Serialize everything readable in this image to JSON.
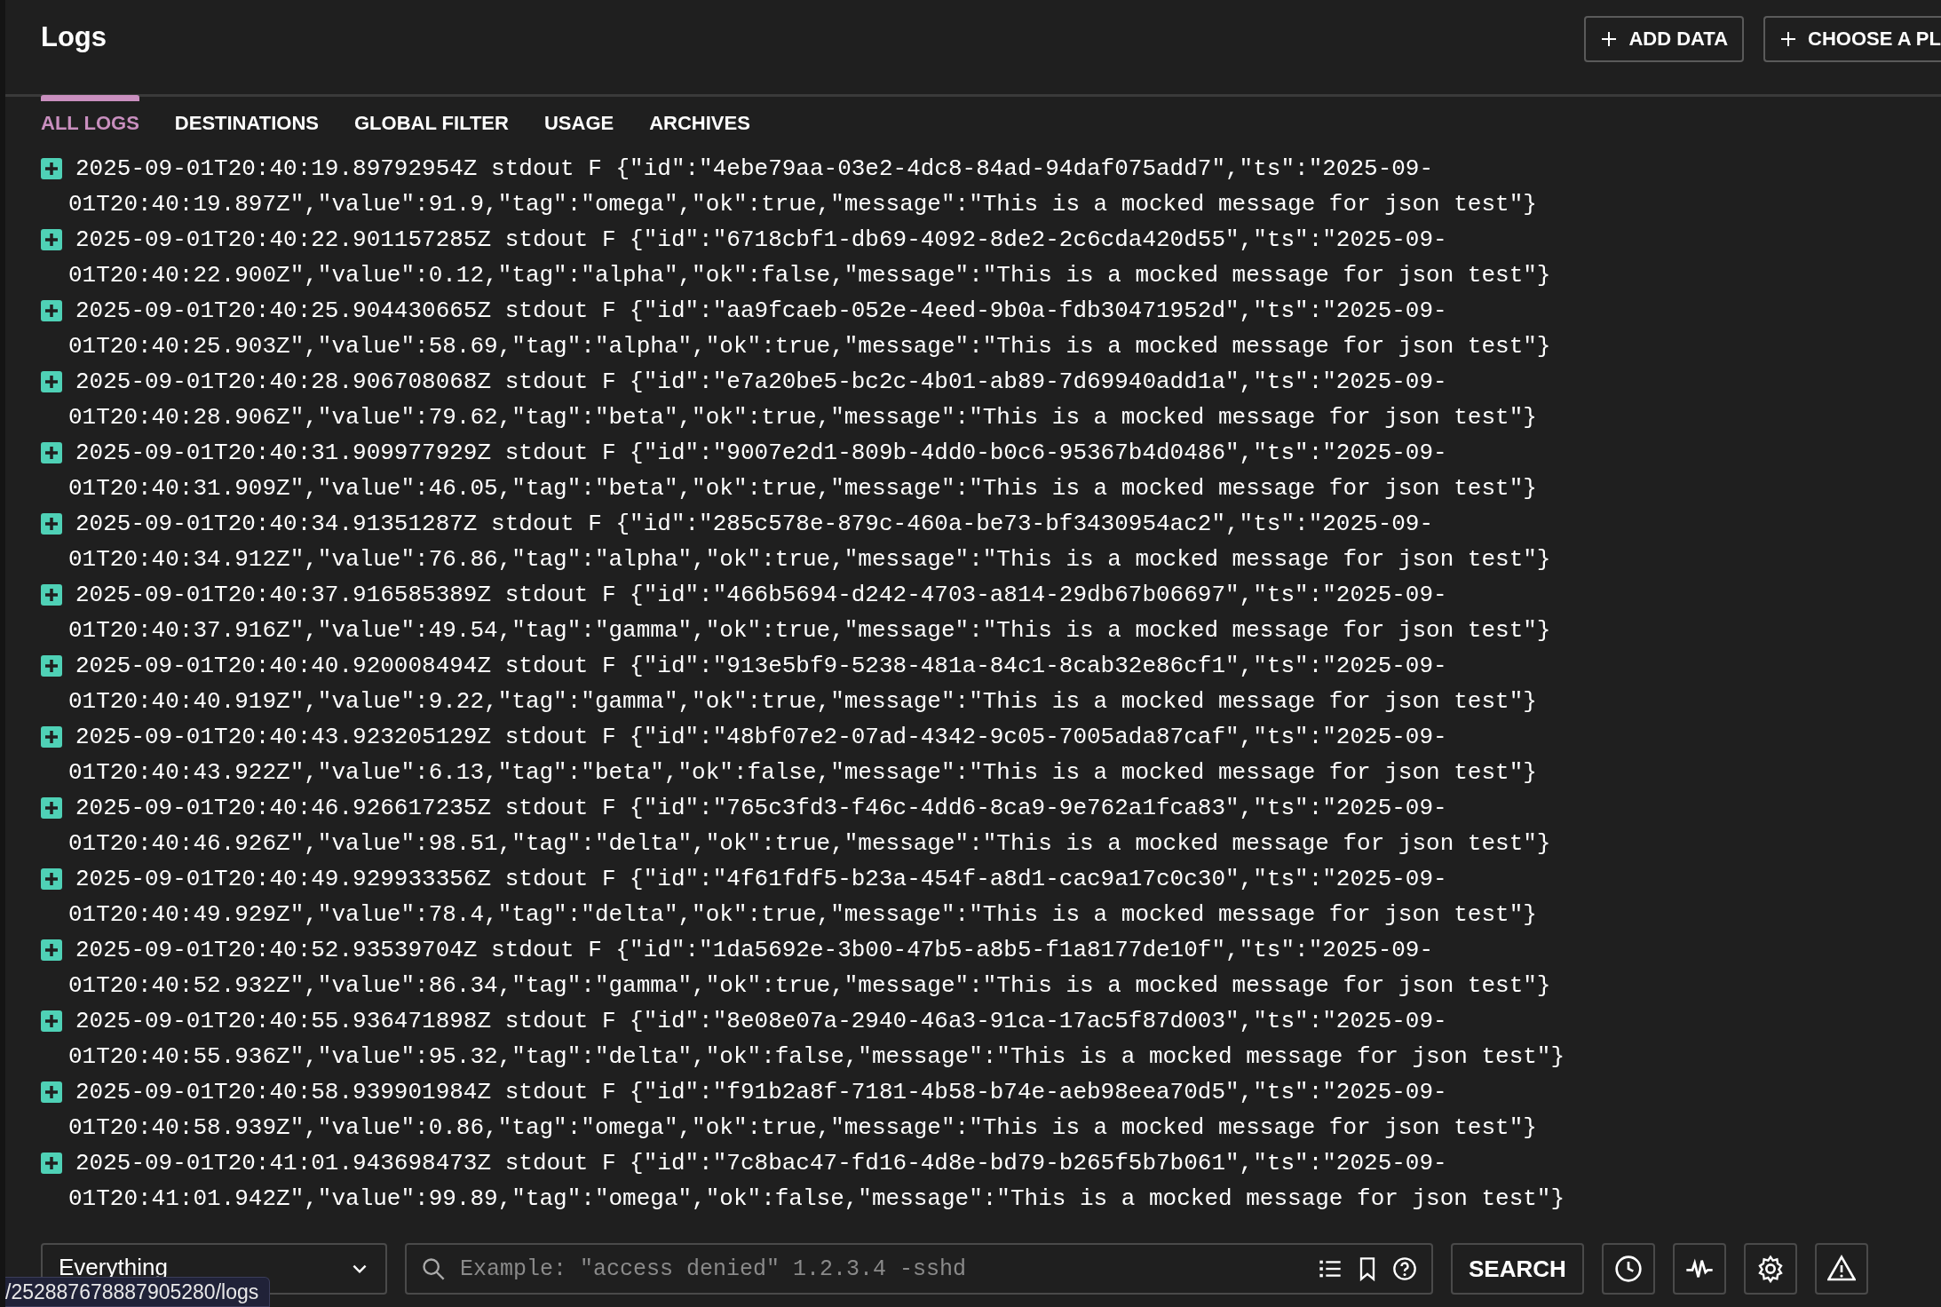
{
  "header": {
    "title": "Logs",
    "buttons": [
      {
        "label": "ADD DATA"
      },
      {
        "label": "CHOOSE A PL"
      }
    ]
  },
  "tabs": [
    {
      "label": "ALL LOGS",
      "selected": true
    },
    {
      "label": "DESTINATIONS",
      "selected": false
    },
    {
      "label": "GLOBAL FILTER",
      "selected": false
    },
    {
      "label": "USAGE",
      "selected": false
    },
    {
      "label": "ARCHIVES",
      "selected": false
    }
  ],
  "logs": [
    {
      "lines": [
        "2025-09-01T20:40:19.89792954Z stdout F {\"id\":\"4ebe79aa-03e2-4dc8-84ad-94daf075add7\",\"ts\":\"2025-09-",
        "01T20:40:19.897Z\",\"value\":91.9,\"tag\":\"omega\",\"ok\":true,\"message\":\"This is a mocked message for json test\"}"
      ]
    },
    {
      "lines": [
        "2025-09-01T20:40:22.901157285Z stdout F {\"id\":\"6718cbf1-db69-4092-8de2-2c6cda420d55\",\"ts\":\"2025-09-",
        "01T20:40:22.900Z\",\"value\":0.12,\"tag\":\"alpha\",\"ok\":false,\"message\":\"This is a mocked message for json test\"}"
      ]
    },
    {
      "lines": [
        "2025-09-01T20:40:25.904430665Z stdout F {\"id\":\"aa9fcaeb-052e-4eed-9b0a-fdb30471952d\",\"ts\":\"2025-09-",
        "01T20:40:25.903Z\",\"value\":58.69,\"tag\":\"alpha\",\"ok\":true,\"message\":\"This is a mocked message for json test\"}"
      ]
    },
    {
      "lines": [
        "2025-09-01T20:40:28.906708068Z stdout F {\"id\":\"e7a20be5-bc2c-4b01-ab89-7d69940add1a\",\"ts\":\"2025-09-",
        "01T20:40:28.906Z\",\"value\":79.62,\"tag\":\"beta\",\"ok\":true,\"message\":\"This is a mocked message for json test\"}"
      ]
    },
    {
      "lines": [
        "2025-09-01T20:40:31.909977929Z stdout F {\"id\":\"9007e2d1-809b-4dd0-b0c6-95367b4d0486\",\"ts\":\"2025-09-",
        "01T20:40:31.909Z\",\"value\":46.05,\"tag\":\"beta\",\"ok\":true,\"message\":\"This is a mocked message for json test\"}"
      ]
    },
    {
      "lines": [
        "2025-09-01T20:40:34.91351287Z stdout F {\"id\":\"285c578e-879c-460a-be73-bf3430954ac2\",\"ts\":\"2025-09-",
        "01T20:40:34.912Z\",\"value\":76.86,\"tag\":\"alpha\",\"ok\":true,\"message\":\"This is a mocked message for json test\"}"
      ]
    },
    {
      "lines": [
        "2025-09-01T20:40:37.916585389Z stdout F {\"id\":\"466b5694-d242-4703-a814-29db67b06697\",\"ts\":\"2025-09-",
        "01T20:40:37.916Z\",\"value\":49.54,\"tag\":\"gamma\",\"ok\":true,\"message\":\"This is a mocked message for json test\"}"
      ]
    },
    {
      "lines": [
        "2025-09-01T20:40:40.920008494Z stdout F {\"id\":\"913e5bf9-5238-481a-84c1-8cab32e86cf1\",\"ts\":\"2025-09-",
        "01T20:40:40.919Z\",\"value\":9.22,\"tag\":\"gamma\",\"ok\":true,\"message\":\"This is a mocked message for json test\"}"
      ]
    },
    {
      "lines": [
        "2025-09-01T20:40:43.923205129Z stdout F {\"id\":\"48bf07e2-07ad-4342-9c05-7005ada87caf\",\"ts\":\"2025-09-",
        "01T20:40:43.922Z\",\"value\":6.13,\"tag\":\"beta\",\"ok\":false,\"message\":\"This is a mocked message for json test\"}"
      ]
    },
    {
      "lines": [
        "2025-09-01T20:40:46.926617235Z stdout F {\"id\":\"765c3fd3-f46c-4dd6-8ca9-9e762a1fca83\",\"ts\":\"2025-09-",
        "01T20:40:46.926Z\",\"value\":98.51,\"tag\":\"delta\",\"ok\":true,\"message\":\"This is a mocked message for json test\"}"
      ]
    },
    {
      "lines": [
        "2025-09-01T20:40:49.929933356Z stdout F {\"id\":\"4f61fdf5-b23a-454f-a8d1-cac9a17c0c30\",\"ts\":\"2025-09-",
        "01T20:40:49.929Z\",\"value\":78.4,\"tag\":\"delta\",\"ok\":true,\"message\":\"This is a mocked message for json test\"}"
      ]
    },
    {
      "lines": [
        "2025-09-01T20:40:52.93539704Z stdout F {\"id\":\"1da5692e-3b00-47b5-a8b5-f1a8177de10f\",\"ts\":\"2025-09-",
        "01T20:40:52.932Z\",\"value\":86.34,\"tag\":\"gamma\",\"ok\":true,\"message\":\"This is a mocked message for json test\"}"
      ]
    },
    {
      "lines": [
        "2025-09-01T20:40:55.936471898Z stdout F {\"id\":\"8e08e07a-2940-46a3-91ca-17ac5f87d003\",\"ts\":\"2025-09-",
        "01T20:40:55.936Z\",\"value\":95.32,\"tag\":\"delta\",\"ok\":false,\"message\":\"This is a mocked message for json test\"}"
      ]
    },
    {
      "lines": [
        "2025-09-01T20:40:58.939901984Z stdout F {\"id\":\"f91b2a8f-7181-4b58-b74e-aeb98eea70d5\",\"ts\":\"2025-09-",
        "01T20:40:58.939Z\",\"value\":0.86,\"tag\":\"omega\",\"ok\":true,\"message\":\"This is a mocked message for json test\"}"
      ]
    },
    {
      "lines": [
        "2025-09-01T20:41:01.943698473Z stdout F {\"id\":\"7c8bac47-fd16-4d8e-bd79-b265f5b7b061\",\"ts\":\"2025-09-",
        "01T20:41:01.942Z\",\"value\":99.89,\"tag\":\"omega\",\"ok\":false,\"message\":\"This is a mocked message for json test\"}"
      ]
    }
  ],
  "query_bar": {
    "dropdown": {
      "value": "Everything"
    },
    "search": {
      "placeholder": "Example: \"access denied\" 1.2.3.4 -sshd"
    },
    "search_button": "SEARCH"
  },
  "status_url": "/252887678887905280/logs"
}
